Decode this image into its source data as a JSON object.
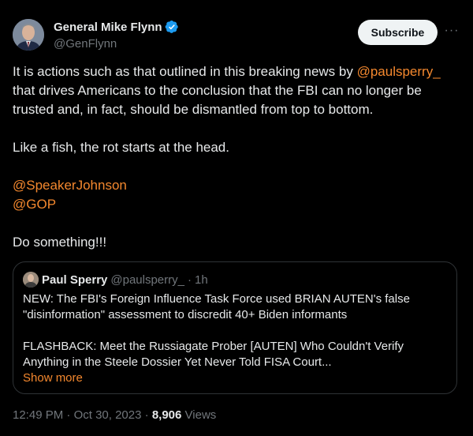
{
  "author": {
    "display_name": "General Mike Flynn",
    "handle": "@GenFlynn"
  },
  "actions": {
    "subscribe_label": "Subscribe",
    "more_label": "···"
  },
  "tweet": {
    "line1_pre": "It is actions such as that outlined in this breaking news by ",
    "line1_mention": "@paulsperry_",
    "line2": "that drives Americans to the conclusion that the FBI can no longer be",
    "line3": "trusted and, in fact, should be dismantled from top to bottom.",
    "line4": "Like a fish, the rot starts at the head.",
    "mention1": "@SpeakerJohnson",
    "mention2": "@GOP",
    "line5": "Do something!!!"
  },
  "quote": {
    "display_name": "Paul Sperry",
    "handle": "@paulsperry_",
    "separator": "·",
    "time": "1h",
    "line1": "NEW: The FBI's Foreign Influence Task Force used BRIAN AUTEN's false",
    "line2": "\"disinformation\" assessment to discredit 40+ Biden informants",
    "line3": "FLASHBACK: Meet the Russiagate Prober [AUTEN] Who Couldn't Verify",
    "line4": "Anything in the Steele Dossier Yet Never Told FISA Court...",
    "show_more": "Show more"
  },
  "meta": {
    "time": "12:49 PM",
    "separator": "·",
    "date": "Oct 30, 2023",
    "views_count": "8,906",
    "views_label": "Views"
  },
  "colors": {
    "background": "#000000",
    "text": "#e7e9ea",
    "secondary": "#71767b",
    "link": "#f4882e",
    "verified": "#1d9bf0",
    "border": "#2f3336"
  }
}
